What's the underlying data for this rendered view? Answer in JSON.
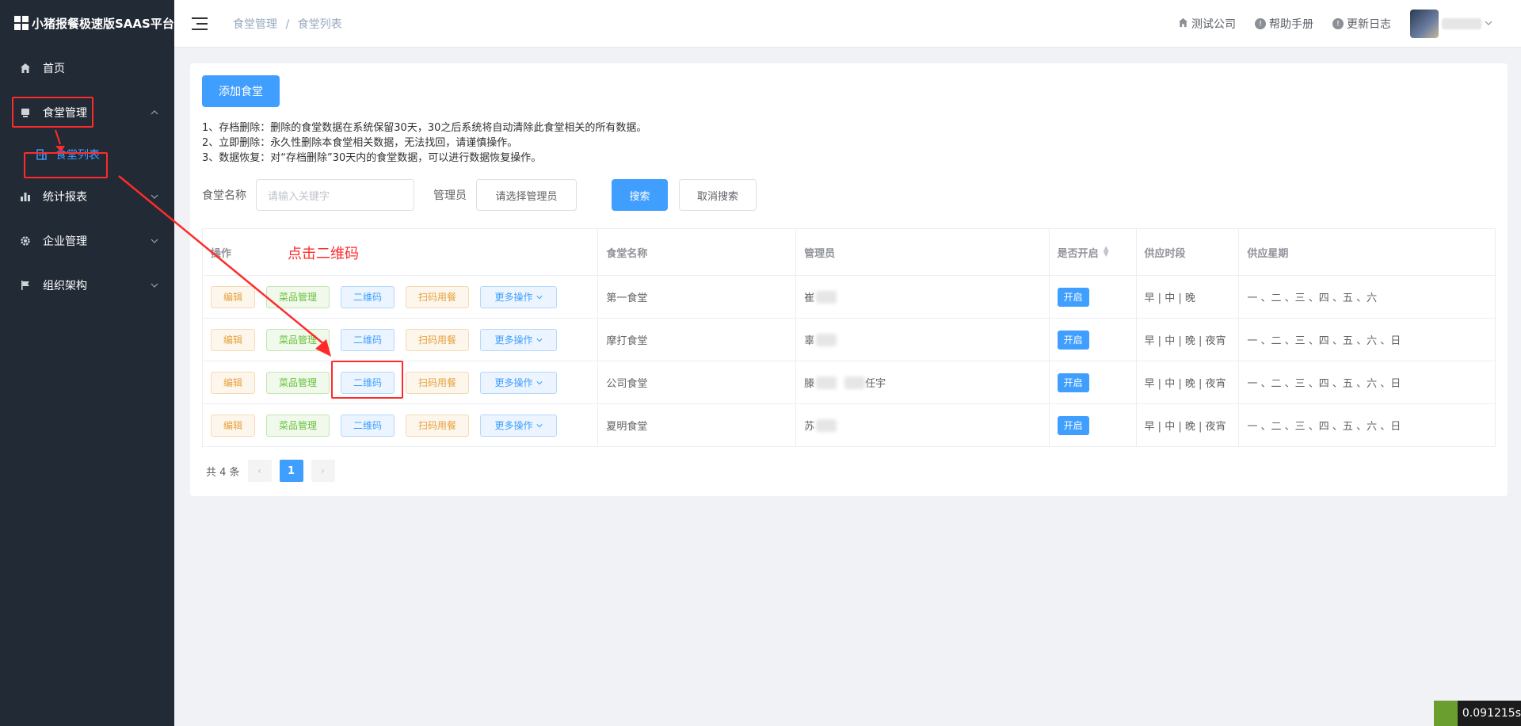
{
  "app": {
    "title": "小猪报餐极速版SAAS平台"
  },
  "sidebar": {
    "items": [
      {
        "label": "首页",
        "icon": "home-icon"
      },
      {
        "label": "食堂管理",
        "icon": "canteen-icon"
      },
      {
        "label": "食堂列表",
        "icon": "building-icon"
      },
      {
        "label": "统计报表",
        "icon": "chart-icon"
      },
      {
        "label": "企业管理",
        "icon": "gear-icon"
      },
      {
        "label": "组织架构",
        "icon": "flag-icon"
      }
    ]
  },
  "header": {
    "breadcrumb": [
      "食堂管理",
      "食堂列表"
    ],
    "breadcrumb_sep": "/",
    "links": [
      "测试公司",
      "帮助手册",
      "更新日志"
    ]
  },
  "main": {
    "add_button": "添加食堂",
    "notes": [
      "1、存档删除：删除的食堂数据在系统保留30天，30之后系统将自动清除此食堂相关的所有数据。",
      "2、立即删除：永久性删除本食堂相关数据，无法找回，请谨慎操作。",
      "3、数据恢复：对“存档删除”30天内的食堂数据，可以进行数据恢复操作。"
    ],
    "search": {
      "name_label": "食堂名称",
      "name_placeholder": "请输入关键字",
      "admin_label": "管理员",
      "admin_select": "请选择管理员",
      "search_button": "搜索",
      "cancel_button": "取消搜索"
    },
    "table": {
      "headers": [
        "操作",
        "食堂名称",
        "管理员",
        "是否开启",
        "供应时段",
        "供应星期"
      ],
      "op_labels": {
        "edit": "编辑",
        "menu": "菜品管理",
        "qr": "二维码",
        "scan": "扫码用餐",
        "more": "更多操作"
      },
      "rows": [
        {
          "name": "第一食堂",
          "admin": "崔",
          "status": "开启",
          "time": "早 | 中 | 晚",
          "week": "一 、二 、三 、四 、五 、六"
        },
        {
          "name": "摩打食堂",
          "admin": "辜",
          "status": "开启",
          "time": "早 | 中 | 晚 | 夜宵",
          "week": "一 、二 、三 、四 、五 、六 、日"
        },
        {
          "name": "公司食堂",
          "admin": "滕",
          "admin_suffix": "任宇",
          "status": "开启",
          "time": "早 | 中 | 晚 | 夜宵",
          "week": "一 、二 、三 、四 、五 、六 、日"
        },
        {
          "name": "夏明食堂",
          "admin": "苏",
          "status": "开启",
          "time": "早 | 中 | 晚 | 夜宵",
          "week": "一 、二 、三 、四 、五 、六 、日"
        }
      ]
    },
    "pagination": {
      "total": "共 4 条",
      "current": "1"
    }
  },
  "annotation": {
    "text": "点击二维码"
  },
  "badge": {
    "text": "0.091215s"
  },
  "colors": {
    "sidebar_bg": "#222a35",
    "primary": "#409eff",
    "annotation_red": "#ff2b2b"
  }
}
